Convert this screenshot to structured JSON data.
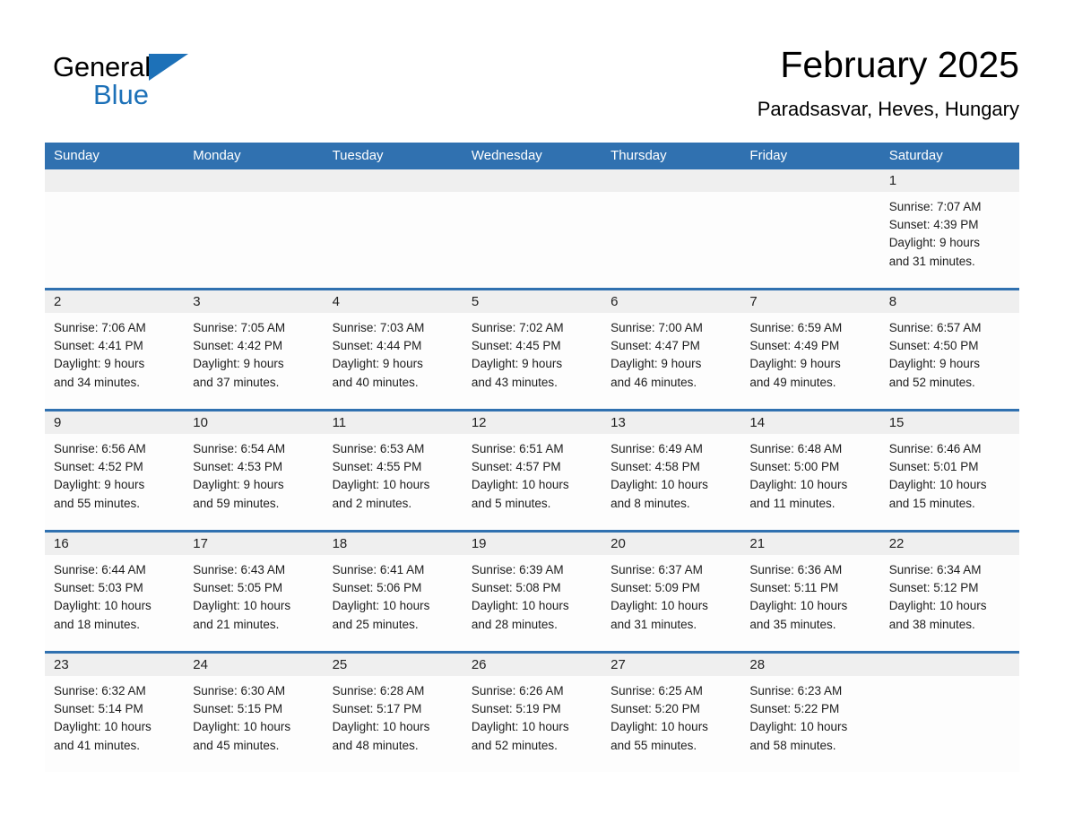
{
  "brand": {
    "name_part1": "General",
    "name_part2": "Blue",
    "flag_icon": "triangle-flag-icon",
    "accent_color": "#1d71b8"
  },
  "header": {
    "title": "February 2025",
    "subtitle": "Paradsasvar, Heves, Hungary"
  },
  "theme": {
    "header_blue": "#3071b0",
    "daynum_band": "#efefef",
    "cell_bg": "#fdfdfd",
    "text": "#1c1c1c"
  },
  "calendar": {
    "weekday_headers": [
      "Sunday",
      "Monday",
      "Tuesday",
      "Wednesday",
      "Thursday",
      "Friday",
      "Saturday"
    ],
    "labels": {
      "sunrise": "Sunrise:",
      "sunset": "Sunset:",
      "daylight": "Daylight:"
    },
    "weeks": [
      [
        {
          "day": "",
          "empty": true
        },
        {
          "day": "",
          "empty": true
        },
        {
          "day": "",
          "empty": true
        },
        {
          "day": "",
          "empty": true
        },
        {
          "day": "",
          "empty": true
        },
        {
          "day": "",
          "empty": true
        },
        {
          "day": "1",
          "sunrise": "Sunrise: 7:07 AM",
          "sunset": "Sunset: 4:39 PM",
          "daylight_l1": "Daylight: 9 hours",
          "daylight_l2": "and 31 minutes."
        }
      ],
      [
        {
          "day": "2",
          "sunrise": "Sunrise: 7:06 AM",
          "sunset": "Sunset: 4:41 PM",
          "daylight_l1": "Daylight: 9 hours",
          "daylight_l2": "and 34 minutes."
        },
        {
          "day": "3",
          "sunrise": "Sunrise: 7:05 AM",
          "sunset": "Sunset: 4:42 PM",
          "daylight_l1": "Daylight: 9 hours",
          "daylight_l2": "and 37 minutes."
        },
        {
          "day": "4",
          "sunrise": "Sunrise: 7:03 AM",
          "sunset": "Sunset: 4:44 PM",
          "daylight_l1": "Daylight: 9 hours",
          "daylight_l2": "and 40 minutes."
        },
        {
          "day": "5",
          "sunrise": "Sunrise: 7:02 AM",
          "sunset": "Sunset: 4:45 PM",
          "daylight_l1": "Daylight: 9 hours",
          "daylight_l2": "and 43 minutes."
        },
        {
          "day": "6",
          "sunrise": "Sunrise: 7:00 AM",
          "sunset": "Sunset: 4:47 PM",
          "daylight_l1": "Daylight: 9 hours",
          "daylight_l2": "and 46 minutes."
        },
        {
          "day": "7",
          "sunrise": "Sunrise: 6:59 AM",
          "sunset": "Sunset: 4:49 PM",
          "daylight_l1": "Daylight: 9 hours",
          "daylight_l2": "and 49 minutes."
        },
        {
          "day": "8",
          "sunrise": "Sunrise: 6:57 AM",
          "sunset": "Sunset: 4:50 PM",
          "daylight_l1": "Daylight: 9 hours",
          "daylight_l2": "and 52 minutes."
        }
      ],
      [
        {
          "day": "9",
          "sunrise": "Sunrise: 6:56 AM",
          "sunset": "Sunset: 4:52 PM",
          "daylight_l1": "Daylight: 9 hours",
          "daylight_l2": "and 55 minutes."
        },
        {
          "day": "10",
          "sunrise": "Sunrise: 6:54 AM",
          "sunset": "Sunset: 4:53 PM",
          "daylight_l1": "Daylight: 9 hours",
          "daylight_l2": "and 59 minutes."
        },
        {
          "day": "11",
          "sunrise": "Sunrise: 6:53 AM",
          "sunset": "Sunset: 4:55 PM",
          "daylight_l1": "Daylight: 10 hours",
          "daylight_l2": "and 2 minutes."
        },
        {
          "day": "12",
          "sunrise": "Sunrise: 6:51 AM",
          "sunset": "Sunset: 4:57 PM",
          "daylight_l1": "Daylight: 10 hours",
          "daylight_l2": "and 5 minutes."
        },
        {
          "day": "13",
          "sunrise": "Sunrise: 6:49 AM",
          "sunset": "Sunset: 4:58 PM",
          "daylight_l1": "Daylight: 10 hours",
          "daylight_l2": "and 8 minutes."
        },
        {
          "day": "14",
          "sunrise": "Sunrise: 6:48 AM",
          "sunset": "Sunset: 5:00 PM",
          "daylight_l1": "Daylight: 10 hours",
          "daylight_l2": "and 11 minutes."
        },
        {
          "day": "15",
          "sunrise": "Sunrise: 6:46 AM",
          "sunset": "Sunset: 5:01 PM",
          "daylight_l1": "Daylight: 10 hours",
          "daylight_l2": "and 15 minutes."
        }
      ],
      [
        {
          "day": "16",
          "sunrise": "Sunrise: 6:44 AM",
          "sunset": "Sunset: 5:03 PM",
          "daylight_l1": "Daylight: 10 hours",
          "daylight_l2": "and 18 minutes."
        },
        {
          "day": "17",
          "sunrise": "Sunrise: 6:43 AM",
          "sunset": "Sunset: 5:05 PM",
          "daylight_l1": "Daylight: 10 hours",
          "daylight_l2": "and 21 minutes."
        },
        {
          "day": "18",
          "sunrise": "Sunrise: 6:41 AM",
          "sunset": "Sunset: 5:06 PM",
          "daylight_l1": "Daylight: 10 hours",
          "daylight_l2": "and 25 minutes."
        },
        {
          "day": "19",
          "sunrise": "Sunrise: 6:39 AM",
          "sunset": "Sunset: 5:08 PM",
          "daylight_l1": "Daylight: 10 hours",
          "daylight_l2": "and 28 minutes."
        },
        {
          "day": "20",
          "sunrise": "Sunrise: 6:37 AM",
          "sunset": "Sunset: 5:09 PM",
          "daylight_l1": "Daylight: 10 hours",
          "daylight_l2": "and 31 minutes."
        },
        {
          "day": "21",
          "sunrise": "Sunrise: 6:36 AM",
          "sunset": "Sunset: 5:11 PM",
          "daylight_l1": "Daylight: 10 hours",
          "daylight_l2": "and 35 minutes."
        },
        {
          "day": "22",
          "sunrise": "Sunrise: 6:34 AM",
          "sunset": "Sunset: 5:12 PM",
          "daylight_l1": "Daylight: 10 hours",
          "daylight_l2": "and 38 minutes."
        }
      ],
      [
        {
          "day": "23",
          "sunrise": "Sunrise: 6:32 AM",
          "sunset": "Sunset: 5:14 PM",
          "daylight_l1": "Daylight: 10 hours",
          "daylight_l2": "and 41 minutes."
        },
        {
          "day": "24",
          "sunrise": "Sunrise: 6:30 AM",
          "sunset": "Sunset: 5:15 PM",
          "daylight_l1": "Daylight: 10 hours",
          "daylight_l2": "and 45 minutes."
        },
        {
          "day": "25",
          "sunrise": "Sunrise: 6:28 AM",
          "sunset": "Sunset: 5:17 PM",
          "daylight_l1": "Daylight: 10 hours",
          "daylight_l2": "and 48 minutes."
        },
        {
          "day": "26",
          "sunrise": "Sunrise: 6:26 AM",
          "sunset": "Sunset: 5:19 PM",
          "daylight_l1": "Daylight: 10 hours",
          "daylight_l2": "and 52 minutes."
        },
        {
          "day": "27",
          "sunrise": "Sunrise: 6:25 AM",
          "sunset": "Sunset: 5:20 PM",
          "daylight_l1": "Daylight: 10 hours",
          "daylight_l2": "and 55 minutes."
        },
        {
          "day": "28",
          "sunrise": "Sunrise: 6:23 AM",
          "sunset": "Sunset: 5:22 PM",
          "daylight_l1": "Daylight: 10 hours",
          "daylight_l2": "and 58 minutes."
        },
        {
          "day": "",
          "empty": true
        }
      ]
    ]
  }
}
